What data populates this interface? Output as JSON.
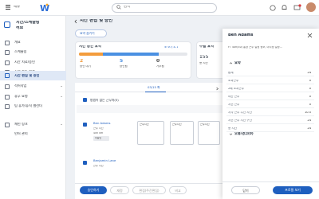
{
  "topbar": {
    "menu_label": "메뉴",
    "search_placeholder": "검색"
  },
  "sidebar": {
    "title_line1": "시간/스케줄링",
    "title_line2": "허브",
    "items": [
      {
        "label": "개요",
        "icon": "overview-icon"
      },
      {
        "label": "스케줄링",
        "icon": "calendar-icon"
      },
      {
        "label": "시간 치료/승인",
        "icon": "clock-icon"
      },
      {
        "label": "시간 카드 분석",
        "icon": "chart-icon"
      },
      {
        "label": "시간 편집 및 승인",
        "icon": "edit-icon",
        "active": true
      },
      {
        "label": "적어작업",
        "icon": "task-icon",
        "chevron": true
      },
      {
        "label": "휴무 요청",
        "icon": "leave-icon",
        "chevron": true
      },
      {
        "label": "팀 휴가/휴직 캘린더",
        "icon": "team-calendar-icon"
      },
      {
        "label": "체인 링크",
        "icon": "link-icon",
        "chevron": true
      },
      {
        "label": "인터 관리",
        "icon": "none"
      }
    ]
  },
  "page": {
    "title": "시간 편집 및 승인",
    "filter_chip": "요약 숨기기",
    "summary_title": "시간 승인 요약",
    "summary_link": "조 보기 & 1",
    "stat1_value": "2",
    "stat1_label": "승인 대기",
    "stat2_value": "5",
    "stat2_label": "승인됨",
    "stat3_value": "0",
    "stat3_label": "거부됨",
    "overtime_title": "주별 요약",
    "overtime_value": "155",
    "overtime_label": "총 시간",
    "date_col": "03/15 화",
    "group_label": "방법이 없는 근무자(5)",
    "employees": [
      {
        "name": "Ben Adams",
        "sub1": "근무 시간",
        "sub2": "40h 0m",
        "badge": "미승인"
      },
      {
        "name": "Benjamin Lane",
        "sub1": "근무 시간",
        "sub2": "",
        "badge": ""
      }
    ],
    "shift_labels": [
      "근무시간",
      "근무시간",
      "근무시간"
    ],
    "bottom_buttons": [
      "승인하기",
      "재정",
      "편집(주간편집)",
      "비교"
    ]
  },
  "panel": {
    "name": "Ben Adams",
    "subtitle": "FT 40h(40) 통상 근무 일정 정보, 미지정 일정...",
    "summary_header": "요약",
    "rows": [
      {
        "k": "합계",
        "v": "24"
      },
      {
        "k": "초과근무",
        "v": "0"
      },
      {
        "k": "2배 초과근무",
        "v": "0"
      },
      {
        "k": "야간 근무",
        "v": "0"
      },
      {
        "k": "지연 근무",
        "v": "0"
      },
      {
        "k": "지각 근무 주간 시간",
        "v": "10.5"
      },
      {
        "k": "지연 근무 시간 구간",
        "v": "24"
      },
      {
        "k": "총 시간",
        "v": "24"
      }
    ],
    "errors_header": "오류/경고(0)",
    "close_button": "닫기",
    "secondary_button": "프로필 보기"
  },
  "colors": {
    "accent": "#1f5fbf",
    "active_bg": "#dfe8f6",
    "orange": "#f39c3c",
    "blue": "#4a90e2",
    "green": "#7cc36a"
  }
}
